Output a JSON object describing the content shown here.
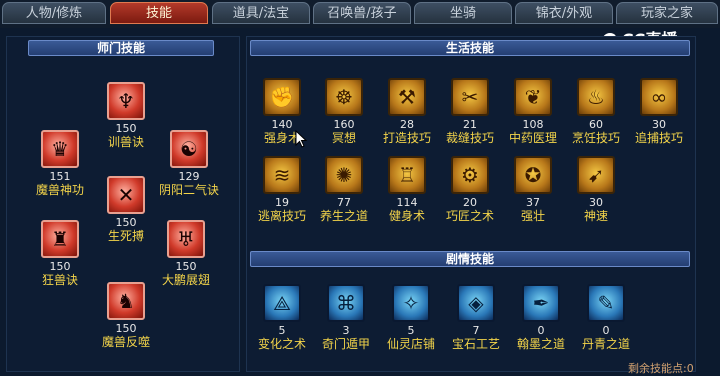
{
  "tabs": [
    "人物/修炼",
    "技能",
    "道具/法宝",
    "召唤兽/孩子",
    "坐骑",
    "锦衣/外观",
    "玩家之家"
  ],
  "active_tab": "技能",
  "logo_text": "CC直播",
  "sections": {
    "shimen": "师门技能",
    "shenghuo": "生活技能",
    "juqing": "剧情技能"
  },
  "shimen_skills": [
    {
      "name": "训兽诀",
      "level": "150",
      "icon": "whip-icon"
    },
    {
      "name": "魔兽神功",
      "level": "151",
      "icon": "beast-head-icon"
    },
    {
      "name": "阴阳二气诀",
      "level": "129",
      "icon": "yin-yang-mask-icon"
    },
    {
      "name": "生死搏",
      "level": "150",
      "icon": "claw-icon"
    },
    {
      "name": "狂兽诀",
      "level": "150",
      "icon": "beetle-icon"
    },
    {
      "name": "大鹏展翅",
      "level": "150",
      "icon": "wing-icon"
    },
    {
      "name": "魔兽反噬",
      "level": "150",
      "icon": "demon-head-icon"
    }
  ],
  "life_skills": [
    {
      "name": "强身术",
      "level": "140",
      "icon": "muscle-icon"
    },
    {
      "name": "冥想",
      "level": "160",
      "icon": "meditation-icon"
    },
    {
      "name": "打造技巧",
      "level": "28",
      "icon": "hammer-icon"
    },
    {
      "name": "裁缝技巧",
      "level": "21",
      "icon": "scissors-icon"
    },
    {
      "name": "中药医理",
      "level": "108",
      "icon": "herb-icon"
    },
    {
      "name": "烹饪技巧",
      "level": "60",
      "icon": "cooking-icon"
    },
    {
      "name": "追捕技巧",
      "level": "30",
      "icon": "rope-icon"
    },
    {
      "name": "逃离技巧",
      "level": "19",
      "icon": "escape-icon"
    },
    {
      "name": "养生之道",
      "level": "77",
      "icon": "health-icon"
    },
    {
      "name": "健身术",
      "level": "114",
      "icon": "fitness-icon"
    },
    {
      "name": "巧匠之术",
      "level": "20",
      "icon": "craftsman-icon"
    },
    {
      "name": "强壮",
      "level": "37",
      "icon": "strong-icon"
    },
    {
      "name": "神速",
      "level": "30",
      "icon": "speed-icon"
    }
  ],
  "story_skills": [
    {
      "name": "变化之术",
      "level": "5",
      "icon": "transform-icon"
    },
    {
      "name": "奇门遁甲",
      "level": "3",
      "icon": "maze-icon"
    },
    {
      "name": "仙灵店铺",
      "level": "5",
      "icon": "shop-icon"
    },
    {
      "name": "宝石工艺",
      "level": "7",
      "icon": "gem-icon"
    },
    {
      "name": "翰墨之道",
      "level": "0",
      "icon": "ink-icon"
    },
    {
      "name": "丹青之道",
      "level": "0",
      "icon": "painting-icon"
    }
  ],
  "footer_text": "剩余技能点:0",
  "glyphs": {
    "whip-icon": "♆",
    "beast-head-icon": "♛",
    "yin-yang-mask-icon": "☯",
    "claw-icon": "✕",
    "beetle-icon": "♜",
    "wing-icon": "♅",
    "demon-head-icon": "♞",
    "muscle-icon": "✊",
    "meditation-icon": "☸",
    "hammer-icon": "⚒",
    "scissors-icon": "✂",
    "herb-icon": "❦",
    "cooking-icon": "♨",
    "rope-icon": "∞",
    "escape-icon": "≋",
    "health-icon": "✺",
    "fitness-icon": "♖",
    "craftsman-icon": "⚙",
    "strong-icon": "✪",
    "speed-icon": "➹",
    "transform-icon": "⟁",
    "maze-icon": "⌘",
    "shop-icon": "✧",
    "gem-icon": "◈",
    "ink-icon": "✒",
    "painting-icon": "✎"
  }
}
